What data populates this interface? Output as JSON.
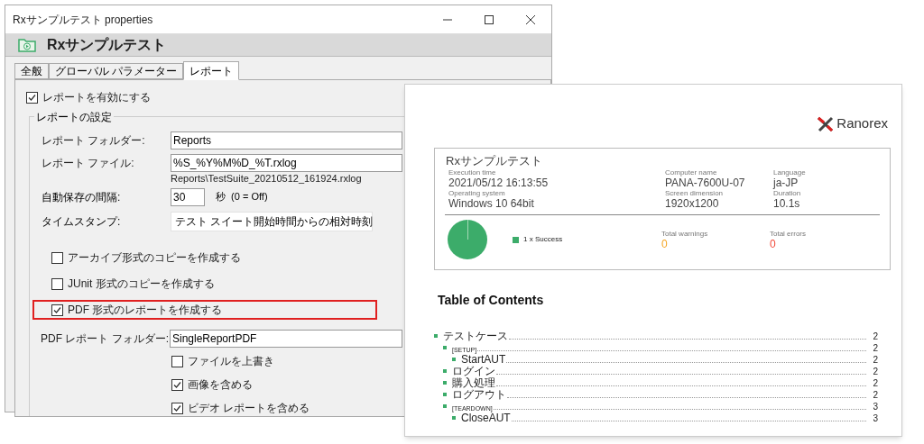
{
  "dialog": {
    "title": "Rxサンプルテスト properties",
    "header_title": "Rxサンプルテスト",
    "tabs": [
      {
        "label": "全般",
        "selected": false
      },
      {
        "label": "グローバル パラメーター",
        "selected": false
      },
      {
        "label": "レポート",
        "selected": true
      }
    ],
    "enable_report": {
      "label": "レポートを有効にする",
      "checked": true
    },
    "group_title": "レポートの設定",
    "report_folder": {
      "label": "レポート フォルダー:",
      "value": "Reports"
    },
    "report_file": {
      "label": "レポート ファイル:",
      "value": "%S_%Y%M%D_%T.rxlog",
      "hint": "Reports\\TestSuite_20210512_161924.rxlog"
    },
    "autosave": {
      "label": "自動保存の間隔:",
      "value": "30",
      "unit": "秒  (0 = Off)"
    },
    "timestamp": {
      "label": "タイムスタンプ:",
      "value": "テスト スイート開始時間からの相対時刻"
    },
    "options": [
      {
        "label": "アーカイブ形式のコピーを作成する",
        "checked": false,
        "highlighted": false
      },
      {
        "label": "JUnit 形式のコピーを作成する",
        "checked": false,
        "highlighted": false
      },
      {
        "label": "PDF 形式のレポートを作成する",
        "checked": true,
        "highlighted": true
      }
    ],
    "pdf_folder": {
      "label": "PDF レポート フォルダー:",
      "value": "SingleReportPDF"
    },
    "pdf_options": [
      {
        "label": "ファイルを上書き",
        "checked": false
      },
      {
        "label": "画像を含める",
        "checked": true
      },
      {
        "label": "ビデオ レポートを含める",
        "checked": true
      }
    ]
  },
  "report": {
    "logo_text": "Ranorex",
    "title": "Rxサンプルテスト",
    "info": [
      {
        "label": "Execution time",
        "value": "2021/05/12 16:13:55"
      },
      {
        "label": "Computer name",
        "value": "PANA-7600U-07"
      },
      {
        "label": "Language",
        "value": "ja-JP"
      },
      {
        "label": "Operating system",
        "value": "Windows 10 64bit"
      },
      {
        "label": "Screen dimension",
        "value": "1920x1200"
      },
      {
        "label": "Duration",
        "value": "10.1s"
      }
    ],
    "legend": {
      "label": "1 x Success",
      "color": "#3cac6a"
    },
    "totals": [
      {
        "label": "Total warnings",
        "value": "0",
        "color": "#f5a623"
      },
      {
        "label": "Total errors",
        "value": "0",
        "color": "#f24a3a"
      }
    ],
    "toc_title": "Table of Contents",
    "toc": [
      {
        "label": "テストケース",
        "page": "2",
        "kind": "item",
        "children": [
          {
            "label": "[SETUP]",
            "page": "2",
            "kind": "section",
            "children": [
              {
                "label": "StartAUT",
                "page": "2",
                "kind": "item"
              }
            ]
          },
          {
            "label": "ログイン",
            "page": "2",
            "kind": "item"
          },
          {
            "label": "購入処理",
            "page": "2",
            "kind": "item"
          },
          {
            "label": "ログアウト",
            "page": "2",
            "kind": "item"
          },
          {
            "label": "[TEARDOWN]",
            "page": "3",
            "kind": "section",
            "children": [
              {
                "label": "CloseAUT",
                "page": "3",
                "kind": "item"
              }
            ]
          }
        ]
      }
    ]
  }
}
